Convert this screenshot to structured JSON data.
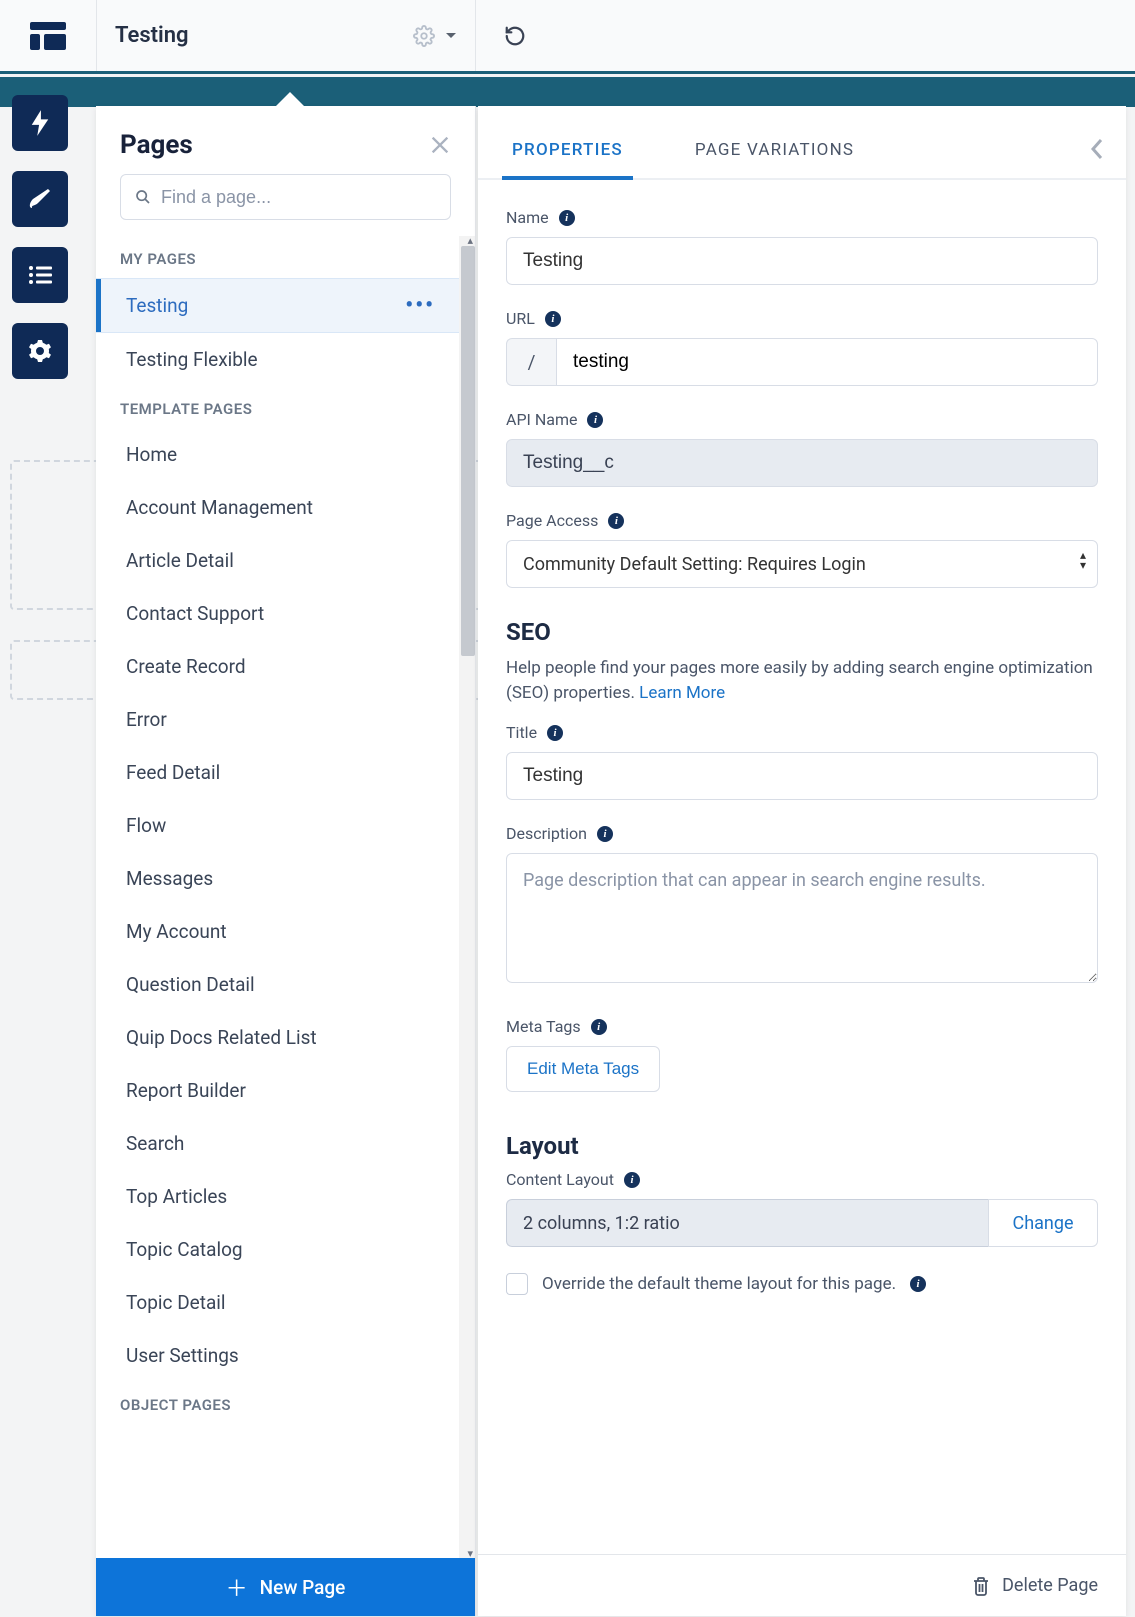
{
  "topbar": {
    "title": "Testing"
  },
  "pages_panel": {
    "heading": "Pages",
    "search_placeholder": "Find a page...",
    "section_my_pages": "MY PAGES",
    "section_template_pages": "TEMPLATE PAGES",
    "section_object_pages": "OBJECT PAGES",
    "my_pages": [
      {
        "label": "Testing",
        "active": true
      },
      {
        "label": "Testing Flexible",
        "active": false
      }
    ],
    "template_pages": [
      "Home",
      "Account Management",
      "Article Detail",
      "Contact Support",
      "Create Record",
      "Error",
      "Feed Detail",
      "Flow",
      "Messages",
      "My Account",
      "Question Detail",
      "Quip Docs Related List",
      "Report Builder",
      "Search",
      "Top Articles",
      "Topic Catalog",
      "Topic Detail",
      "User Settings"
    ],
    "new_page_label": "New Page"
  },
  "props": {
    "tab_properties": "PROPERTIES",
    "tab_variations": "PAGE VARIATIONS",
    "name_label": "Name",
    "name_value": "Testing",
    "url_label": "URL",
    "url_prefix": "/",
    "url_value": "testing",
    "api_label": "API Name",
    "api_value": "Testing__c",
    "access_label": "Page Access",
    "access_value": "Community Default Setting: Requires Login",
    "seo_heading": "SEO",
    "seo_sub": "Help people find your pages more easily by adding search engine optimization (SEO) properties. ",
    "seo_learn": "Learn More",
    "title_label": "Title",
    "title_value": "Testing",
    "desc_label": "Description",
    "desc_placeholder": "Page description that can appear in search engine results.",
    "meta_label": "Meta Tags",
    "meta_btn": "Edit Meta Tags",
    "layout_heading": "Layout",
    "content_layout_label": "Content Layout",
    "content_layout_value": "2 columns, 1:2 ratio",
    "change_label": "Change",
    "override_label": "Override the default theme layout for this page.",
    "delete_label": "Delete Page"
  }
}
